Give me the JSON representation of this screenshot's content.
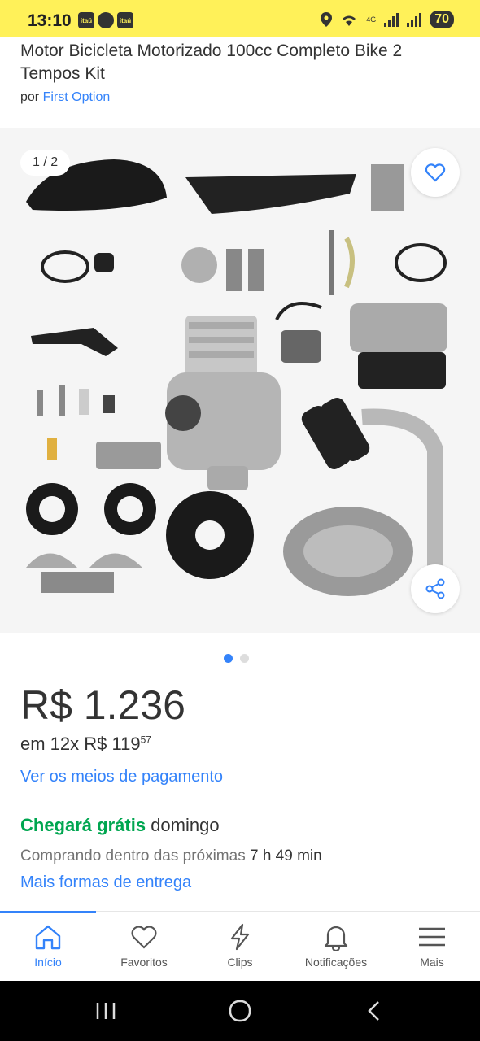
{
  "status": {
    "time": "13:10",
    "badge1": "itaú",
    "badge2": "itaú",
    "battery": "70",
    "net": "4G"
  },
  "product": {
    "title": "Motor Bicicleta Motorizado 100cc Completo Bike 2 Tempos Kit",
    "seller_prefix": "por",
    "seller_name": "First Option"
  },
  "gallery": {
    "counter": "1 / 2",
    "total_images": 2,
    "current_image": 1
  },
  "price": {
    "amount": "R$ 1.236",
    "installment_prefix": "em 12x",
    "installment_value": "R$ 119",
    "installment_cents": "57",
    "payment_link": "Ver os meios de pagamento"
  },
  "shipping": {
    "free_label": "Chegará grátis",
    "day": "domingo",
    "within_text": "Comprando dentro das próximas",
    "within_time": "7 h 49 min",
    "more_link": "Mais formas de entrega"
  },
  "tabs": [
    {
      "label": "Início",
      "icon": "home-icon",
      "active": true
    },
    {
      "label": "Favoritos",
      "icon": "heart-icon",
      "active": false
    },
    {
      "label": "Clips",
      "icon": "lightning-icon",
      "active": false
    },
    {
      "label": "Notificações",
      "icon": "bell-icon",
      "active": false
    },
    {
      "label": "Mais",
      "icon": "menu-icon",
      "active": false
    }
  ],
  "colors": {
    "brand_yellow": "#fff159",
    "link_blue": "#3483fa",
    "green": "#00a650"
  }
}
